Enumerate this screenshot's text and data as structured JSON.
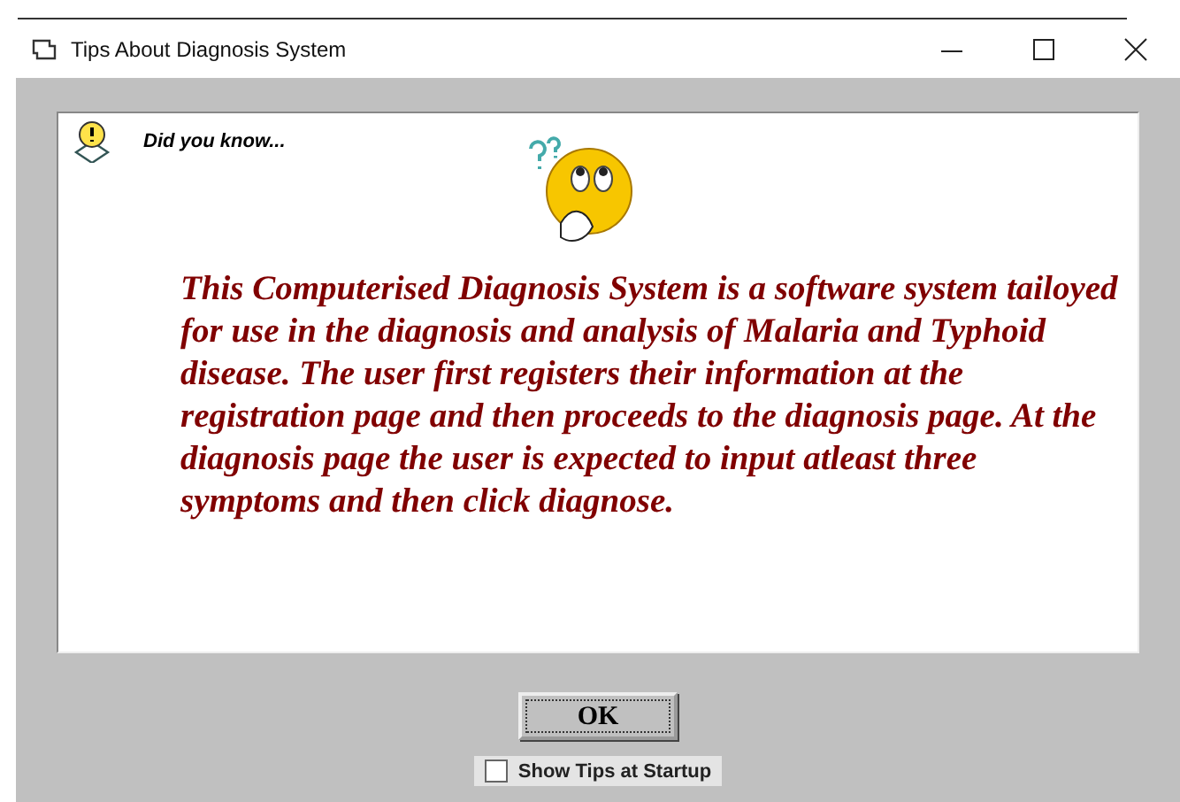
{
  "window": {
    "title": "Tips About Diagnosis System"
  },
  "tip": {
    "heading": "Did you know...",
    "text": "This Computerised Diagnosis System is a software system tailoyed for use in the diagnosis and analysis of Malaria and Typhoid disease. The user first registers their information at the registration page and then proceeds to the diagnosis page. At the diagnosis page the user is expected to input atleast three symptoms and then click diagnose."
  },
  "buttons": [
    "OK"
  ],
  "show_tips": {
    "label": "Show Tips at Startup",
    "checked": false
  }
}
